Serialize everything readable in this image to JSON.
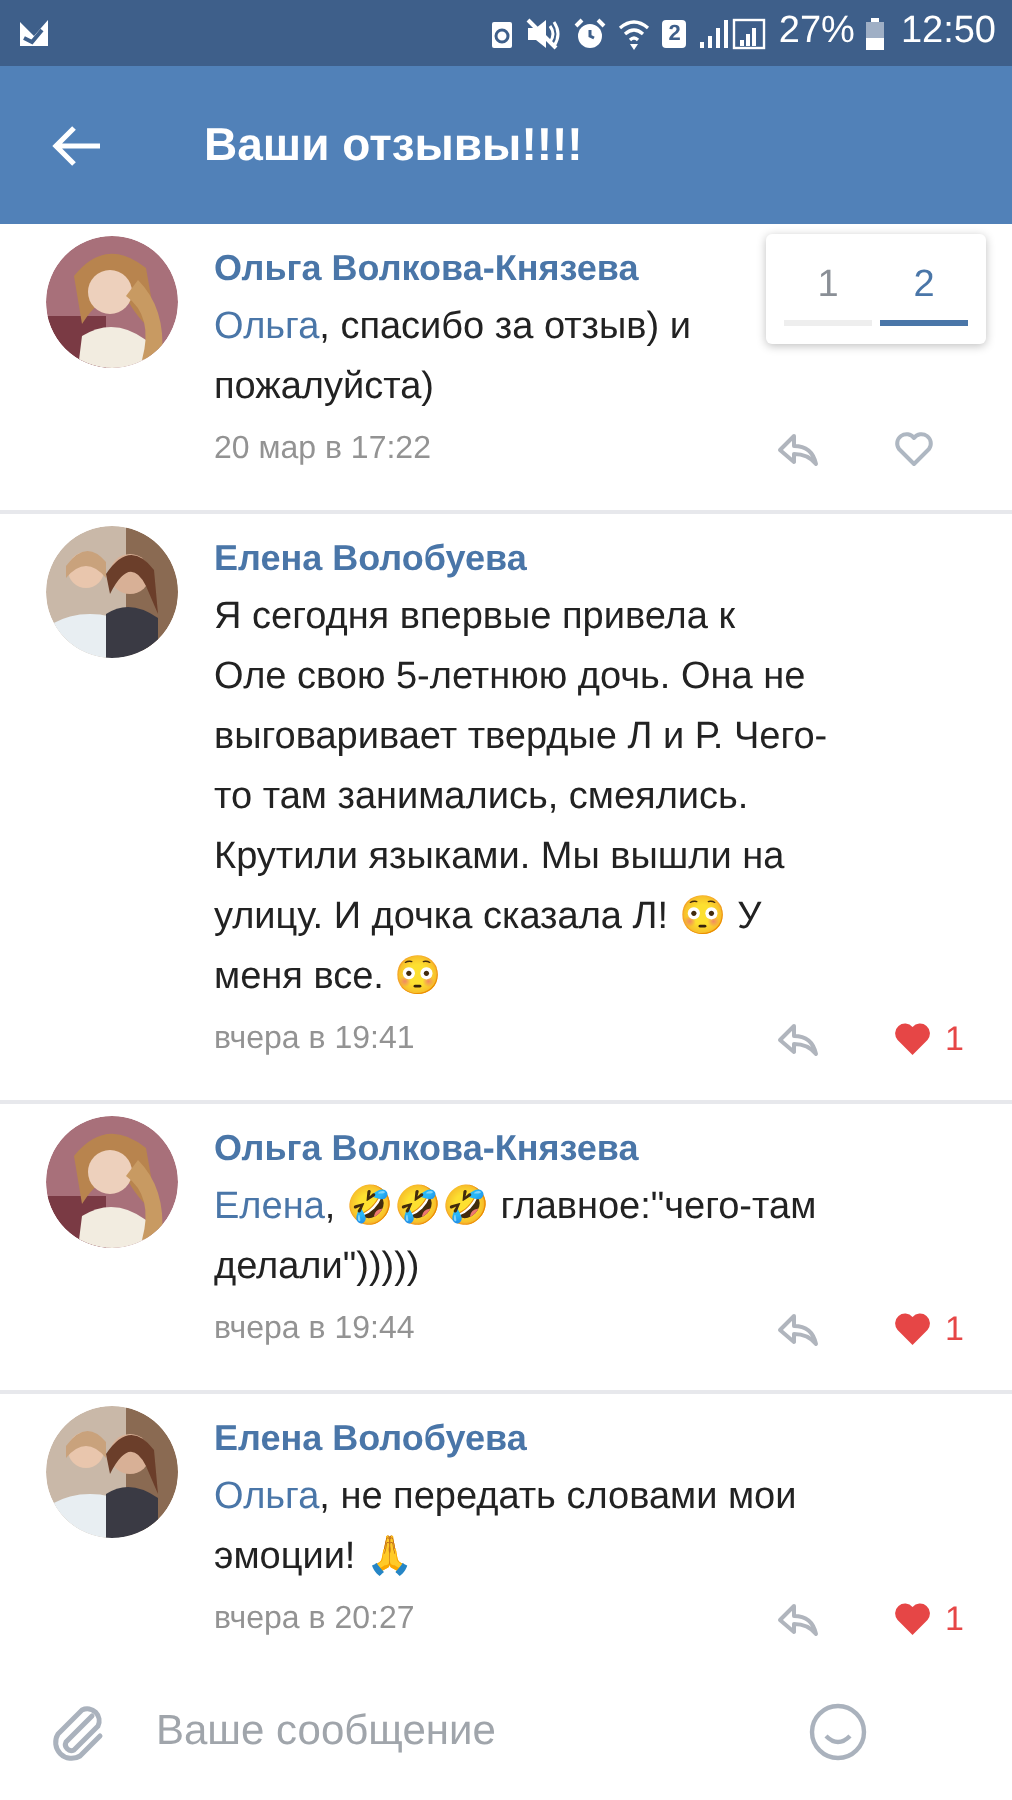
{
  "status_bar": {
    "sim": "2",
    "battery": "27%",
    "time": "12:50"
  },
  "header": {
    "title": "Ваши отзывы!!!!"
  },
  "pager": [
    {
      "label": "1",
      "selected": false
    },
    {
      "label": "2",
      "selected": true
    }
  ],
  "comments": [
    {
      "author": "Ольга Волкова-Князева",
      "mention": "Ольга",
      "lines": [
        ", спасибо за отзыв) и",
        "пожалуйста)"
      ],
      "time": "20 мар в 17:22",
      "liked": false
    },
    {
      "author": "Елена Волобуева",
      "lines": [
        "Я сегодня впервые привела к",
        "Оле свою 5-летнюю дочь. Она не",
        "выговаривает твердые Л и Р. Чего-",
        "то там занимались, смеялись.",
        "Крутили языками. Мы вышли на",
        "улицу. И дочка сказала Л! 😳 У",
        "меня все. 😳"
      ],
      "time": "вчера в 19:41",
      "liked": true,
      "likes": "1"
    },
    {
      "author": "Ольга Волкова-Князева",
      "mention": "Елена",
      "lines": [
        ", 🤣🤣🤣 главное:\"чего-там",
        "делали\")))))"
      ],
      "time": "вчера в 19:44",
      "liked": true,
      "likes": "1"
    },
    {
      "author": "Елена Волобуева",
      "mention": "Ольга",
      "lines": [
        ", не передать словами мои",
        "эмоции! 🙏"
      ],
      "time": "вчера в 20:27",
      "liked": true,
      "likes": "1"
    }
  ],
  "composer": {
    "placeholder": "Ваше сообщение"
  }
}
